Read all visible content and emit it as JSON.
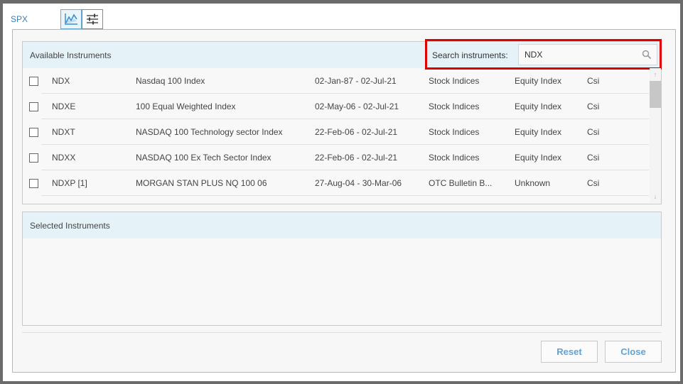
{
  "topbar": {
    "symbol": "SPX",
    "chart_tool_icon": "line-chart-icon",
    "settings_tool_icon": "sliders-icon"
  },
  "available": {
    "title": "Available Instruments",
    "search_label": "Search instruments:",
    "search_value": "NDX",
    "search_icon": "search-icon",
    "rows": [
      {
        "symbol": "NDX",
        "name": "Nasdaq 100 Index",
        "range": "02-Jan-87 - 02-Jul-21",
        "category": "Stock Indices",
        "type": "Equity Index",
        "source": "Csi"
      },
      {
        "symbol": "NDXE",
        "name": "100 Equal Weighted Index",
        "range": "02-May-06 - 02-Jul-21",
        "category": "Stock Indices",
        "type": "Equity Index",
        "source": "Csi"
      },
      {
        "symbol": "NDXT",
        "name": "NASDAQ 100 Technology sector Index",
        "range": "22-Feb-06 - 02-Jul-21",
        "category": "Stock Indices",
        "type": "Equity Index",
        "source": "Csi"
      },
      {
        "symbol": "NDXX",
        "name": "NASDAQ 100 Ex Tech Sector Index",
        "range": "22-Feb-06 - 02-Jul-21",
        "category": "Stock Indices",
        "type": "Equity Index",
        "source": "Csi"
      },
      {
        "symbol": "NDXP [1]",
        "name": "MORGAN STAN PLUS NQ 100 06",
        "range": "27-Aug-04 - 30-Mar-06",
        "category": "OTC Bulletin B...",
        "type": "Unknown",
        "source": "Csi"
      }
    ]
  },
  "selected": {
    "title": "Selected Instruments"
  },
  "buttons": {
    "reset": "Reset",
    "close": "Close"
  },
  "colors": {
    "accent": "#5fa3d6",
    "header_bg": "#e5f2f8",
    "highlight": "#e00000"
  }
}
